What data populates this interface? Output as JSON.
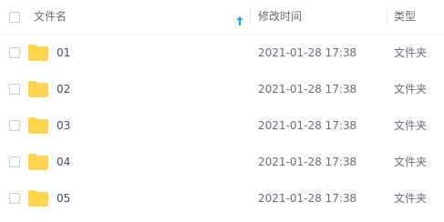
{
  "header": {
    "name_label": "文件名",
    "modified_label": "修改时间",
    "type_label": "类型",
    "sort_icon": "arrow-up-icon",
    "accent_color": "#06a7ff"
  },
  "folder_color": "#ffd54f",
  "rows": [
    {
      "name": "01",
      "modified": "2021-01-28 17:38",
      "type": "文件夹"
    },
    {
      "name": "02",
      "modified": "2021-01-28 17:38",
      "type": "文件夹"
    },
    {
      "name": "03",
      "modified": "2021-01-28 17:38",
      "type": "文件夹"
    },
    {
      "name": "04",
      "modified": "2021-01-28 17:38",
      "type": "文件夹"
    },
    {
      "name": "05",
      "modified": "2021-01-28 17:38",
      "type": "文件夹"
    }
  ]
}
